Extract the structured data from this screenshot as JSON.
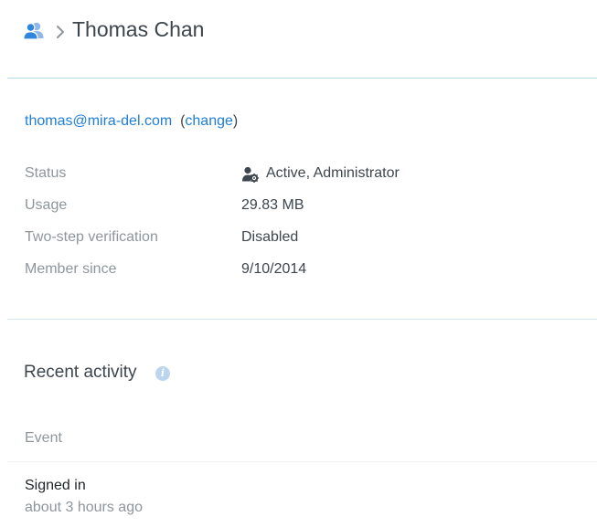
{
  "header": {
    "icon": "users-icon",
    "separator_icon": "chevron-right-icon",
    "title": "Thomas Chan"
  },
  "account": {
    "email": "thomas@mira-del.com",
    "open_paren": "(",
    "change_label": "change",
    "close_paren": ")"
  },
  "details": {
    "status": {
      "label": "Status",
      "value": "Active, Administrator",
      "icon": "admin-gear-icon"
    },
    "usage": {
      "label": "Usage",
      "value": "29.83 MB"
    },
    "two_step": {
      "label": "Two-step verification",
      "value": "Disabled"
    },
    "member_since": {
      "label": "Member since",
      "value": "9/10/2014"
    }
  },
  "recent_activity": {
    "title": "Recent activity",
    "info_icon": "info-icon",
    "column_header": "Event",
    "events": [
      {
        "name": "Signed in",
        "time": "about 3 hours ago"
      }
    ]
  },
  "colors": {
    "link": "#1f7ed6",
    "muted_text": "#8e969c",
    "primary_text": "#3d464d",
    "header_divider": "#b9dbe7",
    "info_icon": "#bcd5ee"
  }
}
